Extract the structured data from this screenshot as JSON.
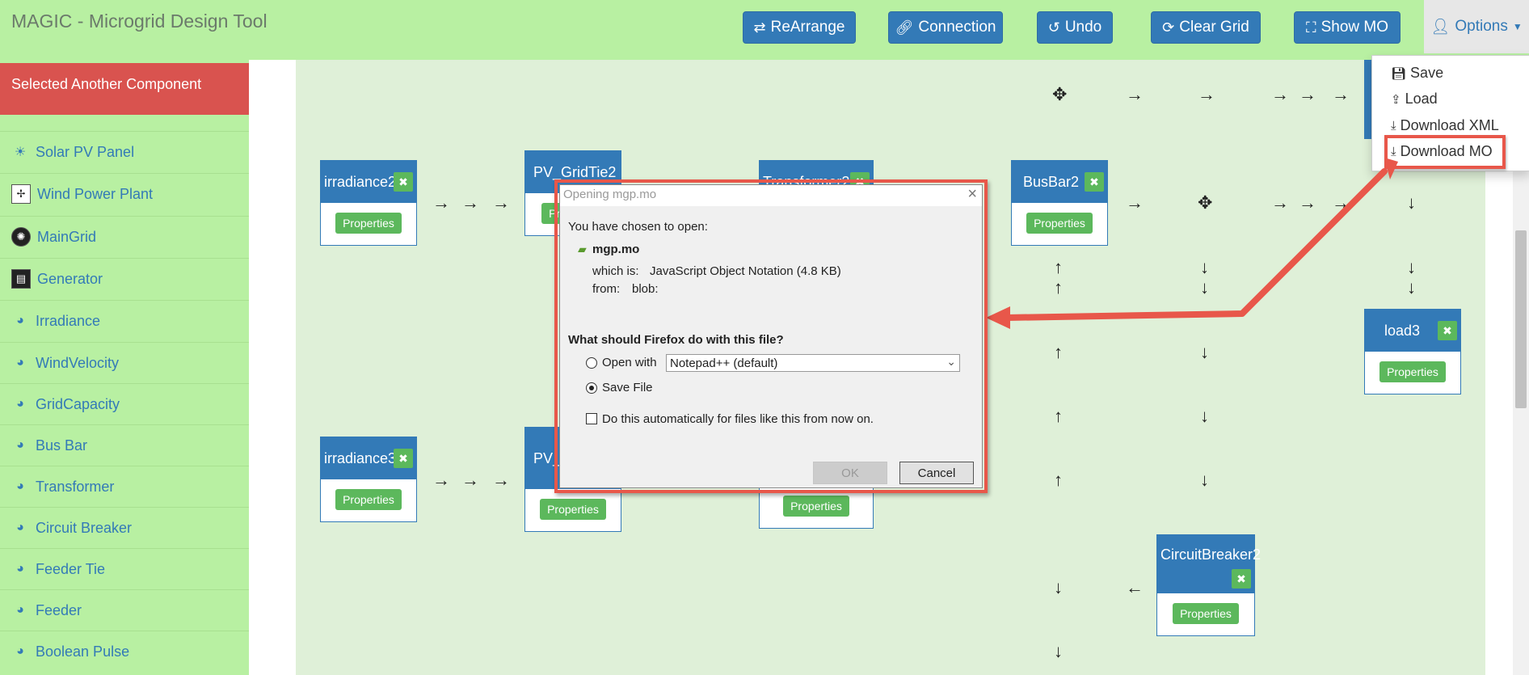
{
  "app": {
    "title": "MAGIC - Microgrid Design Tool"
  },
  "toolbar": {
    "buttons": [
      {
        "label": "ReArrange",
        "icon": "arrows-exchange-icon"
      },
      {
        "label": "Connection",
        "icon": "link-icon"
      },
      {
        "label": "Undo",
        "icon": "undo-icon"
      },
      {
        "label": "Clear Grid",
        "icon": "refresh-icon"
      },
      {
        "label": "Show MO",
        "icon": "sitemap-icon"
      }
    ],
    "options_label": "Options"
  },
  "options_menu": {
    "items": [
      {
        "label": "Save",
        "icon": "floppy-icon"
      },
      {
        "label": "Load",
        "icon": "upload-icon"
      },
      {
        "label": "Download XML",
        "icon": "download-icon"
      },
      {
        "label": "Download MO",
        "icon": "download-icon"
      }
    ]
  },
  "sidebar": {
    "selected_banner": "Selected Another Component",
    "items": [
      {
        "label": "Solar PV Panel",
        "icon": "solar-panel-icon"
      },
      {
        "label": "Wind Power Plant",
        "icon": "wind-turbine-icon"
      },
      {
        "label": "MainGrid",
        "icon": "maingrid-icon"
      },
      {
        "label": "Generator",
        "icon": "generator-icon"
      },
      {
        "label": "Irradiance",
        "icon": "dashboard-icon"
      },
      {
        "label": "WindVelocity",
        "icon": "dashboard-icon"
      },
      {
        "label": "GridCapacity",
        "icon": "dashboard-icon"
      },
      {
        "label": "Bus Bar",
        "icon": "dashboard-icon"
      },
      {
        "label": "Transformer",
        "icon": "dashboard-icon"
      },
      {
        "label": "Circuit Breaker",
        "icon": "dashboard-icon"
      },
      {
        "label": "Feeder Tie",
        "icon": "dashboard-icon"
      },
      {
        "label": "Feeder",
        "icon": "dashboard-icon"
      },
      {
        "label": "Boolean Pulse",
        "icon": "dashboard-icon"
      }
    ]
  },
  "grid": {
    "properties_label": "Properties",
    "nodes": {
      "irradiance2": "irradiance2",
      "pv_gridtie2": "PV_GridTie2",
      "transformer": "Transformer2",
      "busbar2": "BusBar2",
      "load3": "load3",
      "irradiance3": "irradiance3",
      "pv2": "PV_",
      "circuitbreaker2": "CircuitBreaker2"
    }
  },
  "dialog": {
    "title": "Opening mgp.mo",
    "intro": "You have chosen to open:",
    "filename": "mgp.mo",
    "which_is_label": "which is:",
    "which_is_value": "JavaScript Object Notation (4.8 KB)",
    "from_label": "from:",
    "from_value": "blob:",
    "question": "What should Firefox do with this file?",
    "open_with_label": "Open with",
    "open_with_app": "Notepad++ (default)",
    "save_file_label": "Save File",
    "auto_label": "Do this automatically for files like this from now on.",
    "ok_label": "OK",
    "cancel_label": "Cancel",
    "selected_option": "Save File"
  }
}
